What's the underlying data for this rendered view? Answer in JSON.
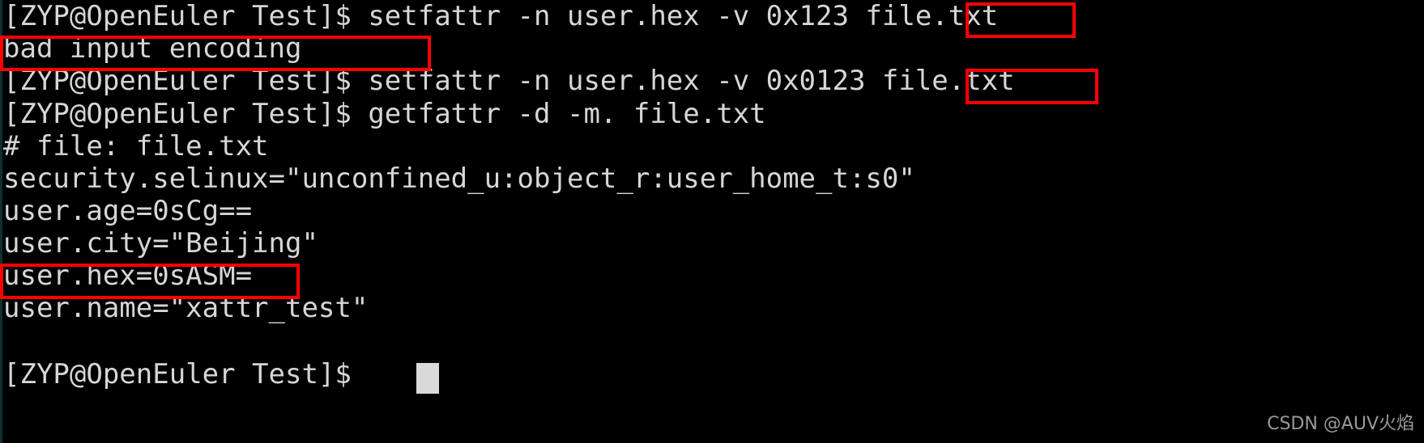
{
  "terminal": {
    "prompt": "[ZYP@OpenEuler Test]$ ",
    "background_color": "#000000",
    "text_color": "#d6d6d6",
    "highlight_color": "#fe0000",
    "cursor_color": "#d9d9d9",
    "lines": [
      {
        "id": "cmd-setfattr-bad",
        "text": "[ZYP@OpenEuler Test]$ setfattr -n user.hex -v 0x123 file.txt"
      },
      {
        "id": "output-bad-input-encoding",
        "text": "bad input encoding"
      },
      {
        "id": "cmd-setfattr-good",
        "text": "[ZYP@OpenEuler Test]$ setfattr -n user.hex -v 0x0123 file.txt"
      },
      {
        "id": "cmd-getfattr",
        "text": "[ZYP@OpenEuler Test]$ getfattr -d -m. file.txt"
      },
      {
        "id": "output-file-header",
        "text": "# file: file.txt"
      },
      {
        "id": "output-security-selinux",
        "text": "security.selinux=\"unconfined_u:object_r:user_home_t:s0\""
      },
      {
        "id": "output-user-age",
        "text": "user.age=0sCg=="
      },
      {
        "id": "output-user-city",
        "text": "user.city=\"Beijing\""
      },
      {
        "id": "output-user-hex",
        "text": "user.hex=0sASM="
      },
      {
        "id": "output-user-name",
        "text": "user.name=\"xattr_test\""
      },
      {
        "id": "blank",
        "text": ""
      },
      {
        "id": "prompt-final",
        "text": "[ZYP@OpenEuler Test]$ "
      }
    ],
    "highlights": [
      {
        "id": "hl-0x123",
        "label": "0x123"
      },
      {
        "id": "hl-bad-input-encoding",
        "label": "bad input encoding"
      },
      {
        "id": "hl-0x0123",
        "label": "0x0123"
      },
      {
        "id": "hl-user-hex",
        "label": "user.hex=0sASM="
      }
    ],
    "cursor": {
      "visible": true
    }
  },
  "watermark": {
    "text": "CSDN @AUV火焰"
  }
}
